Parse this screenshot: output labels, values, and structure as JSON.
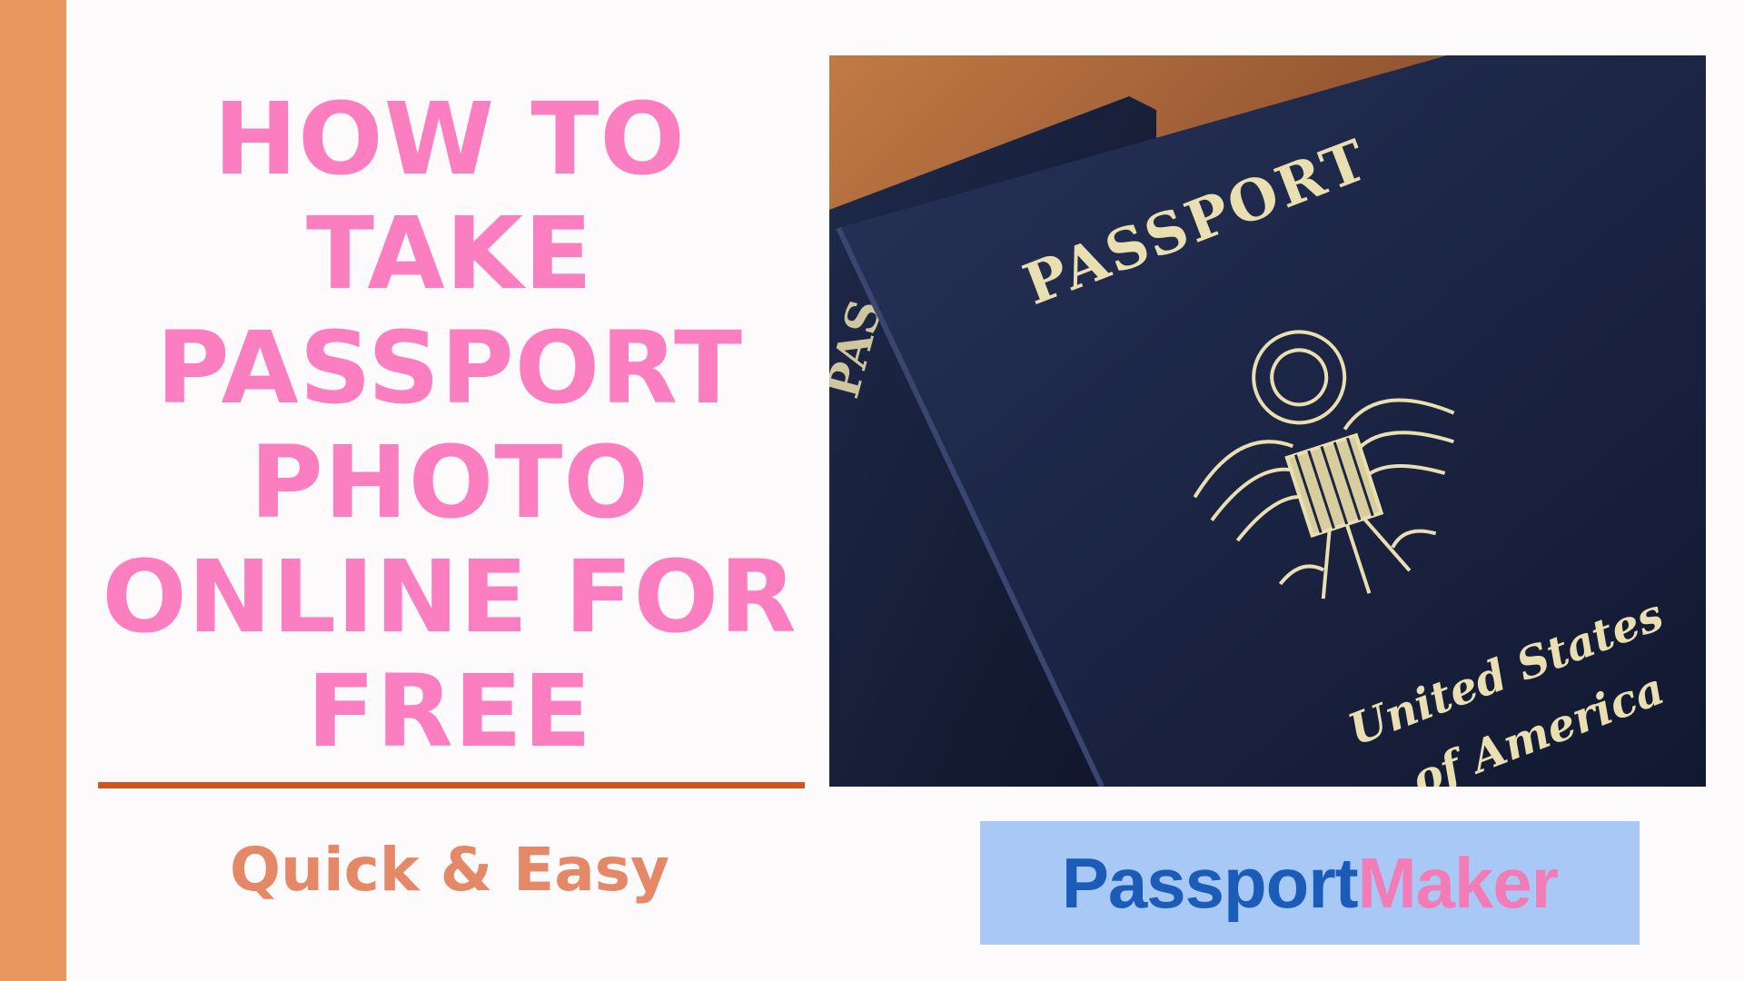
{
  "headline": {
    "lines": [
      "HOW TO",
      "TAKE",
      "PASSPORT",
      "PHOTO",
      "ONLINE FOR",
      "FREE"
    ]
  },
  "tagline": "Quick & Easy",
  "photo": {
    "cover_title": "PASSPORT",
    "country_line_1": "United States",
    "country_line_2": "of America",
    "back_cover_partial": "PAS"
  },
  "logo": {
    "part_1": "Passport",
    "part_2": "Maker"
  },
  "colors": {
    "left_bar": "#e8965e",
    "headline": "#fb7ec1",
    "divider": "#d2561c",
    "tagline": "#e58867",
    "logo_background": "#a8c8f5",
    "logo_part_1": "#1a5cb8",
    "logo_part_2": "#f37cb6",
    "passport_cover": "#1c2545",
    "passport_gold": "#e9dfb0"
  }
}
